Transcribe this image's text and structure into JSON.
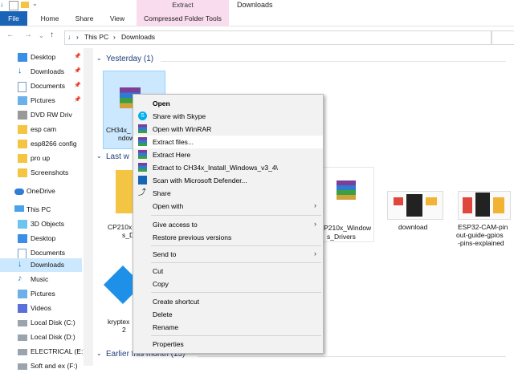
{
  "window": {
    "title": "Downloads",
    "context_tab_group": "Extract"
  },
  "ribbon": {
    "tabs": [
      "File",
      "Home",
      "Share",
      "View",
      "Compressed Folder Tools"
    ]
  },
  "address": {
    "crumbs": [
      "This PC",
      "Downloads"
    ],
    "sep": "›"
  },
  "sidebar": {
    "items": [
      {
        "label": "Desktop",
        "icon": "desktop-icon",
        "pinned": true
      },
      {
        "label": "Downloads",
        "icon": "download-icon",
        "pinned": true
      },
      {
        "label": "Documents",
        "icon": "documents-icon",
        "pinned": true
      },
      {
        "label": "Pictures",
        "icon": "pictures-icon",
        "pinned": true
      },
      {
        "label": "DVD RW Driv",
        "icon": "dvd-icon",
        "pinned": false
      },
      {
        "label": "esp cam",
        "icon": "folder-icon",
        "pinned": false
      },
      {
        "label": "esp8266 config",
        "icon": "folder-icon",
        "pinned": false
      },
      {
        "label": "pro up",
        "icon": "folder-icon",
        "pinned": false
      },
      {
        "label": "Screenshots",
        "icon": "folder-icon",
        "pinned": false
      },
      {
        "label": "OneDrive",
        "icon": "onedrive-icon",
        "pinned": false
      },
      {
        "label": "This PC",
        "icon": "pc-icon",
        "pinned": false
      },
      {
        "label": "3D Objects",
        "icon": "cube-icon",
        "pinned": false
      },
      {
        "label": "Desktop",
        "icon": "desktop-icon",
        "pinned": false
      },
      {
        "label": "Documents",
        "icon": "documents-icon",
        "pinned": false
      },
      {
        "label": "Downloads",
        "icon": "download-icon",
        "pinned": false,
        "selected": true
      },
      {
        "label": "Music",
        "icon": "music-icon",
        "pinned": false
      },
      {
        "label": "Pictures",
        "icon": "pictures-icon",
        "pinned": false
      },
      {
        "label": "Videos",
        "icon": "videos-icon",
        "pinned": false
      },
      {
        "label": "Local Disk (C:)",
        "icon": "disk-icon",
        "pinned": false
      },
      {
        "label": "Local Disk (D:)",
        "icon": "disk-icon",
        "pinned": false
      },
      {
        "label": "ELECTRICAL (E:)",
        "icon": "disk-icon",
        "pinned": false
      },
      {
        "label": "Soft and ex (F:)",
        "icon": "disk-icon",
        "pinned": false
      }
    ]
  },
  "groups": {
    "yesterday": "Yesterday (1)",
    "last_week": "Last w",
    "earlier_month": "Earlier this month (15)"
  },
  "files": {
    "selected": {
      "label_l1": "CH34x_",
      "label_l2": "ndow"
    },
    "cp210x_a": {
      "label_l1": "CP210x",
      "label_l2": "s_D"
    },
    "cp210x_b": {
      "label_l1": "CP210x_Window",
      "label_l2": "s_Drivers"
    },
    "download": {
      "label_l1": "download",
      "label_l2": ""
    },
    "esp32": {
      "label_l1": "ESP32-CAM-pin",
      "label_l2": "out-guide-gpios",
      "label_l3": "-pins-explained"
    },
    "krypto": {
      "label_l1": "kryptex",
      "label_l2": "2"
    }
  },
  "context_menu": {
    "items": [
      {
        "label": "Open",
        "bold": true,
        "icon": ""
      },
      {
        "label": "Share with Skype",
        "icon": "skype-icon"
      },
      {
        "label": "Open with WinRAR",
        "icon": "winrar-icon"
      },
      {
        "label": "Extract files...",
        "icon": "winrar-icon",
        "hover": true
      },
      {
        "label": "Extract Here",
        "icon": "winrar-icon"
      },
      {
        "label": "Extract to CH34x_Install_Windows_v3_4\\",
        "icon": "winrar-icon"
      },
      {
        "label": "Scan with Microsoft Defender...",
        "icon": "defender-icon"
      },
      {
        "label": "Share",
        "icon": "share-icon"
      },
      {
        "label": "Open with",
        "icon": "",
        "submenu": true
      },
      {
        "label": "Give access to",
        "icon": "",
        "submenu": true
      },
      {
        "label": "Restore previous versions",
        "icon": ""
      },
      {
        "label": "Send to",
        "icon": "",
        "submenu": true
      },
      {
        "label": "Cut",
        "icon": ""
      },
      {
        "label": "Copy",
        "icon": ""
      },
      {
        "label": "Create shortcut",
        "icon": ""
      },
      {
        "label": "Delete",
        "icon": ""
      },
      {
        "label": "Rename",
        "icon": ""
      },
      {
        "label": "Properties",
        "icon": ""
      }
    ],
    "submenu_arrow": "›"
  },
  "colors": {
    "accent": "#1a64b7",
    "selection": "#cce8ff",
    "context_tab": "#f9dced"
  }
}
